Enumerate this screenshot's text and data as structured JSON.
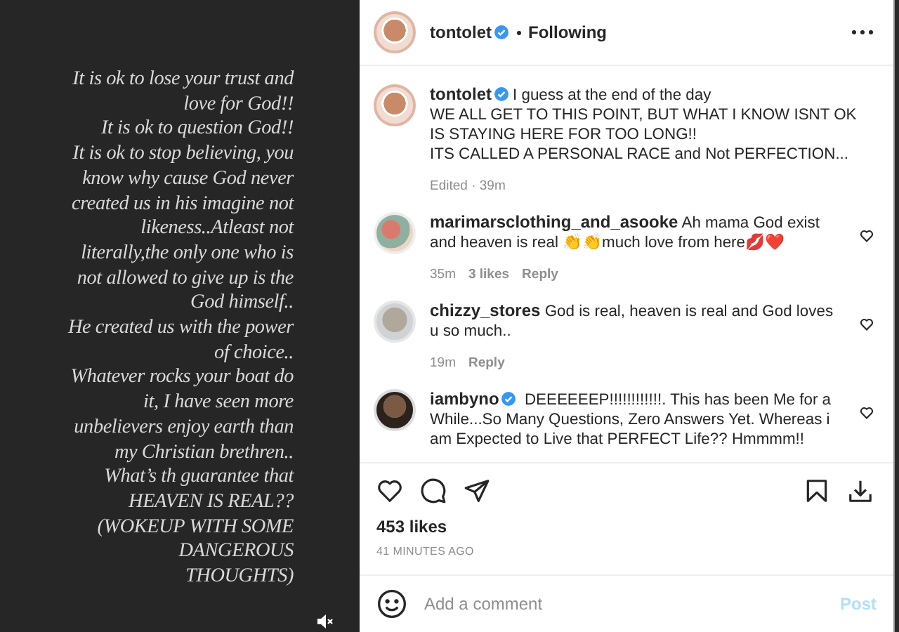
{
  "story": {
    "text": "It is ok to lose your trust and\nlove for God!!\nIt is ok to  question God!!\nIt is ok to stop believing, you\nknow why cause God never\ncreated us in his imagine not\nlikeness..Atleast not\nliterally,the only one who is\nnot allowed to give up is the\nGod himself..\nHe created us with the power\nof choice..\nWhatever rocks your boat do\nit, I have seen more\nunbelievers enjoy earth than\nmy Christian brethren..\nWhat’s th guarantee that\nHEAVEN IS REAL??\n(WOKEUP WITH SOME\nDANGEROUS\nTHOUGHTS)"
  },
  "post": {
    "header": {
      "username": "tontolet",
      "verified": true,
      "follow_status": "Following"
    },
    "caption": {
      "username": "tontolet",
      "verified": true,
      "text": "I guess at the end of the day\nWE ALL GET TO THIS POINT, BUT WHAT I KNOW ISNT OK IS STAYING HERE FOR TOO LONG!!\nITS CALLED A PERSONAL RACE and Not PERFECTION...",
      "meta": "Edited · 39m"
    },
    "comments": [
      {
        "username": "marimarsclothing_and_asooke",
        "verified": false,
        "text": "Ah mama God exist and heaven is real 👏👏much love from here💋❤️",
        "time": "35m",
        "likes": "3 likes",
        "reply": "Reply"
      },
      {
        "username": "chizzy_stores",
        "verified": false,
        "text": "God is real, heaven is real and God loves u so much..",
        "time": "19m",
        "reply": "Reply"
      },
      {
        "username": "iambyno",
        "verified": true,
        "text": "DEEEEEEP!!!!!!!!!!!!. This has been Me for a While...So Many Questions, Zero Answers Yet. Whereas i am Expected to Live that PERFECT Life?? Hmmmm!!"
      }
    ],
    "likes": "453 likes",
    "time": "41 MINUTES AGO",
    "comment_field": {
      "placeholder": "Add a comment",
      "post_button": "Post",
      "post_disabled": true
    }
  }
}
